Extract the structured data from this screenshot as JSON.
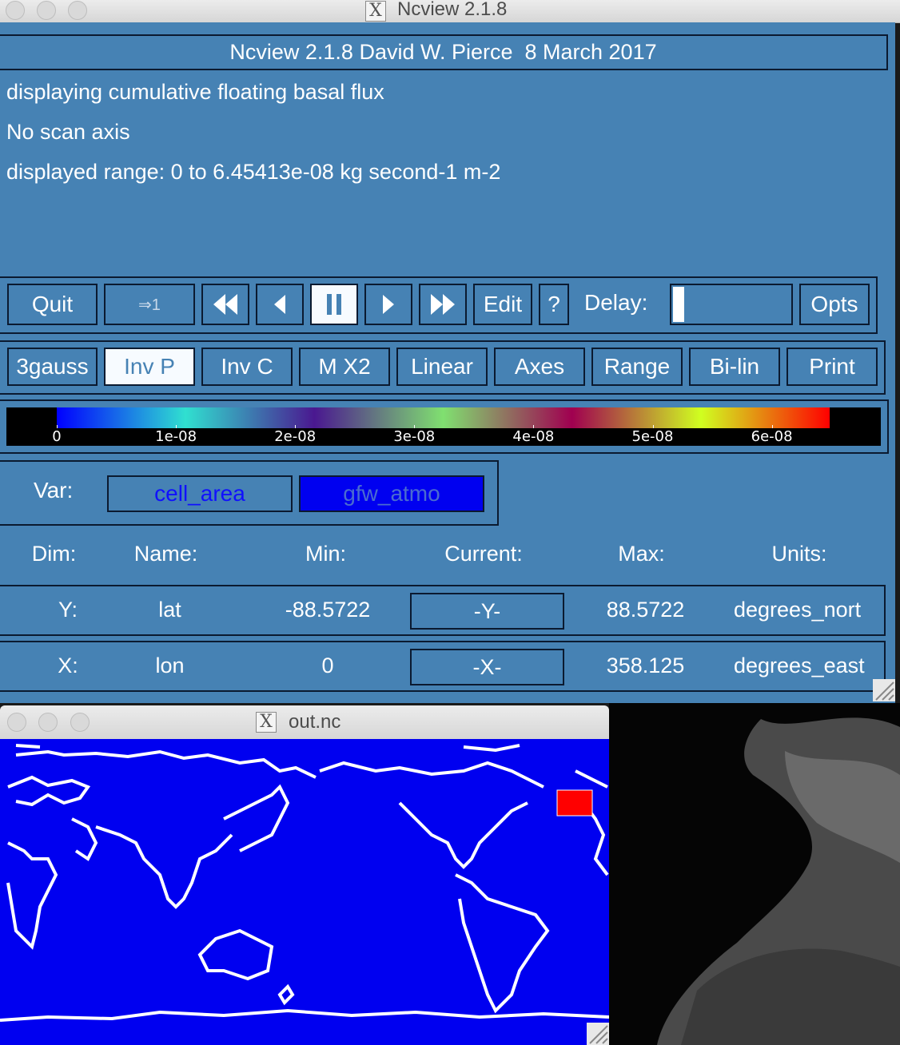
{
  "main_window": {
    "title": "Ncview 2.1.8",
    "version_banner": "Ncview 2.1.8 David W. Pierce  8 March 2017",
    "info": [
      "displaying cumulative floating basal flux",
      "No scan axis",
      "displayed range: 0 to 6.45413e-08 kg second-1 m-2"
    ],
    "controls": {
      "quit": "Quit",
      "frame_step": "⇒1",
      "edit": "Edit",
      "help": "?",
      "delay_label": "Delay:",
      "opts": "Opts"
    },
    "options": [
      "3gauss",
      "Inv P",
      "Inv C",
      "M X2",
      "Linear",
      "Axes",
      "Range",
      "Bi-lin",
      "Print"
    ],
    "active_option": "Inv P",
    "colorbar": {
      "ticks": [
        "0",
        "1e-08",
        "2e-08",
        "3e-08",
        "4e-08",
        "5e-08",
        "6e-08"
      ],
      "colors": [
        "#0000ff",
        "#30e0d0",
        "#4a1890",
        "#80e070",
        "#a00050",
        "#d0ff20",
        "#ff0000"
      ]
    },
    "var_label": "Var:",
    "vars": [
      "cell_area",
      "gfw_atmo"
    ],
    "selected_var": "gfw_atmo",
    "dim_headers": [
      "Dim:",
      "Name:",
      "Min:",
      "Current:",
      "Max:",
      "Units:"
    ],
    "dims": [
      {
        "dim": "Y:",
        "name": "lat",
        "min": "-88.5722",
        "current": "-Y-",
        "max": "88.5722",
        "units": "degrees_nort"
      },
      {
        "dim": "X:",
        "name": "lon",
        "min": "0",
        "current": "-X-",
        "max": "358.125",
        "units": "degrees_east"
      }
    ]
  },
  "map_window": {
    "title": "out.nc",
    "colors": {
      "background": "#0000f0",
      "coastline": "#ffffff",
      "highlight": "#ff0000"
    }
  }
}
